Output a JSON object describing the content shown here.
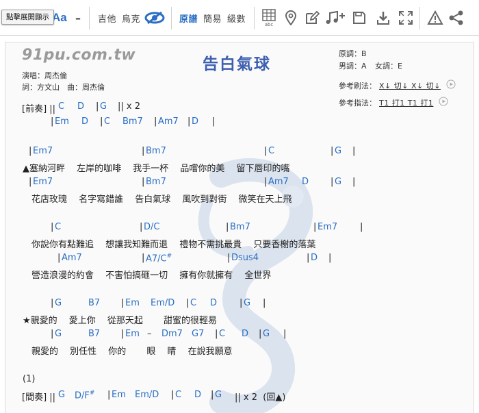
{
  "toolbar": {
    "tooltip": "點擊展開顯示",
    "font_size_label": "Aa",
    "minus_label": "–",
    "guitar": "吉他",
    "ukulele": "烏克",
    "original": "原譜",
    "simple": "簡易",
    "level": "級數",
    "icons": [
      "eye-slash-icon",
      "chord-chart-icon",
      "pin-icon",
      "edit-icon",
      "music-add-icon",
      "save-icon",
      "download-icon",
      "fullscreen-icon",
      "warning-icon",
      "share-icon"
    ],
    "accent_color": "#2a6fc4"
  },
  "sheet": {
    "site": "91pu.com.tw",
    "title": "告白氣球",
    "singer": "演唱：周杰倫",
    "credits": "詞：方文山　曲：周杰倫",
    "original_key": "原調：B",
    "male_key": "男調：A",
    "female_key": "女調：E",
    "strum_label": "參考刷法：",
    "strum_pattern": "X↓ 切↓ X↓ 切↓",
    "pick_label": "參考指法：",
    "pick_pattern": "T1 打1 T1 打1",
    "intro_label": "[前奏] ||",
    "interlude_label": "[間奏] ||",
    "note_1": "(1)",
    "lines": {
      "intro1": [
        "C",
        "D",
        "G",
        "|| x 2"
      ],
      "intro2": [
        "Em",
        "D",
        "C",
        "Bm7",
        "Am7",
        "D"
      ],
      "v1c": [
        "Em7",
        "Bm7",
        "C",
        "G"
      ],
      "v1l": "▲塞納河畔　 左岸的咖啡　 我手一杯　 品嚐你的美　 留下唇印的嘴",
      "v2c": [
        "Em7",
        "Bm7",
        "Am7",
        "D",
        "G"
      ],
      "v2l": "　花店玫瑰　 名字寫錯誰　 告白氣球　 風吹到對街　 微笑在天上飛",
      "v3c": [
        "C",
        "D/C",
        "Bm7",
        "Em7"
      ],
      "v3l": "　你說你有點難追　 想讓我知難而退　 禮物不需挑最貴　 只要香榭的落葉",
      "v4c": [
        "Am7",
        "A7/C#",
        "Dsus4",
        "D"
      ],
      "v4l": "　營造浪漫的約會　 不害怕搞砸一切　 擁有你就擁有　 全世界",
      "c1c": [
        "G",
        "B7",
        "Em",
        "Em/D",
        "C",
        "D",
        "G"
      ],
      "c1l": "★親愛的　 愛上你　 從那天起　　 甜蜜的很輕易",
      "c2c": [
        "G",
        "B7",
        "Em",
        "–",
        "Dm7",
        "G7",
        "C",
        "D",
        "G"
      ],
      "c2l": "　親愛的　 別任性　 你的　　 眼　 睛　 在說我願意",
      "inter": [
        "G",
        "D/F#",
        "Em",
        "Em/D",
        "C",
        "D",
        "G",
        "|| x 2  (回▲)"
      ]
    }
  }
}
